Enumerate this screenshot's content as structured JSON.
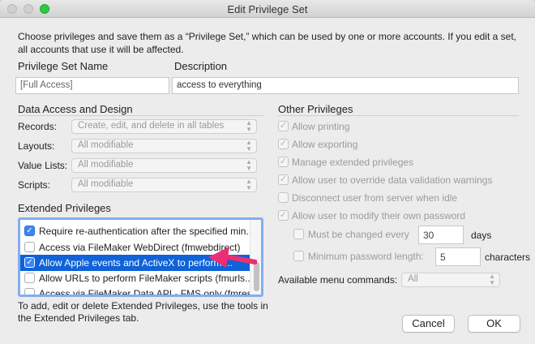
{
  "window": {
    "title": "Edit Privilege Set"
  },
  "intro": "Choose privileges and save them as a “Privilege Set,” which can be used by one or more accounts. If you edit a set, all accounts that use it will be affected.",
  "name": {
    "label": "Privilege Set Name",
    "value": "[Full Access]"
  },
  "description": {
    "label": "Description",
    "value": "access to everything"
  },
  "data_access": {
    "heading": "Data Access and Design",
    "rows": [
      {
        "label": "Records:",
        "value": "Create, edit, and delete in all tables"
      },
      {
        "label": "Layouts:",
        "value": "All modifiable"
      },
      {
        "label": "Value Lists:",
        "value": "All modifiable"
      },
      {
        "label": "Scripts:",
        "value": "All modifiable"
      }
    ]
  },
  "extended": {
    "heading": "Extended Privileges",
    "items": [
      {
        "label": "Require re-authentication after the specified min...",
        "checked": true,
        "selected": false
      },
      {
        "label": "Access via FileMaker WebDirect (fmwebdirect)",
        "checked": false,
        "selected": false
      },
      {
        "label": "Allow Apple events and ActiveX to perform ...",
        "checked": true,
        "selected": true
      },
      {
        "label": "Allow URLs to perform FileMaker scripts (fmurls...",
        "checked": false,
        "selected": false
      },
      {
        "label": "Access via FileMaker Data API - FMS only (fmrest)",
        "checked": false,
        "selected": false
      }
    ],
    "note": "To add, edit or delete Extended Privileges, use the tools in the Extended Privileges tab."
  },
  "other": {
    "heading": "Other Privileges",
    "items": [
      {
        "label": "Allow printing",
        "checked": true
      },
      {
        "label": "Allow exporting",
        "checked": true
      },
      {
        "label": "Manage extended privileges",
        "checked": true
      },
      {
        "label": "Allow user to override data validation warnings",
        "checked": true
      },
      {
        "label": "Disconnect user from server when idle",
        "checked": false
      },
      {
        "label": "Allow user to modify their own password",
        "checked": true
      }
    ],
    "must_change": {
      "label": "Must be changed every",
      "value": "30",
      "unit": "days"
    },
    "min_length": {
      "label": "Minimum password length:",
      "value": "5",
      "unit": "characters"
    },
    "menu": {
      "label": "Available menu commands:",
      "value": "All"
    }
  },
  "buttons": {
    "cancel": "Cancel",
    "ok": "OK"
  },
  "colors": {
    "accent": "#0f62d8",
    "arrow": "#ec2f72"
  }
}
